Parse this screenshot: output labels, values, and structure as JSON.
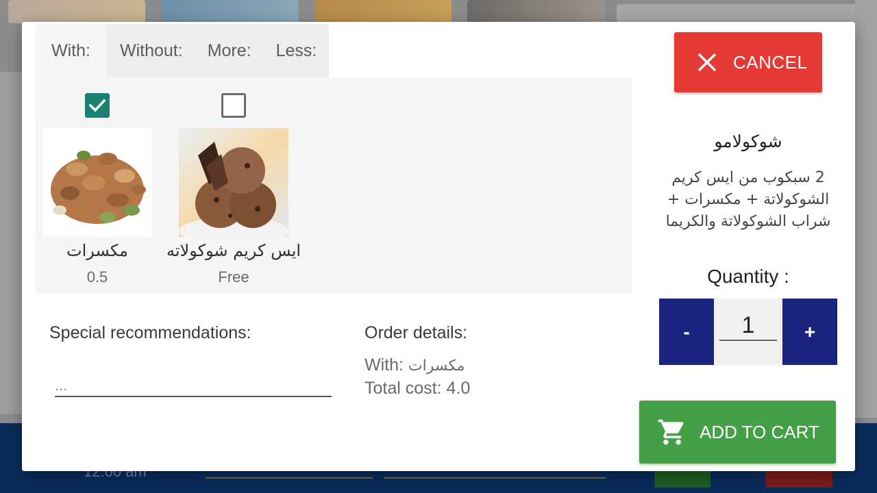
{
  "tabs": [
    {
      "label": "With:",
      "active": true
    },
    {
      "label": "Without:",
      "active": false
    },
    {
      "label": "More:",
      "active": false
    },
    {
      "label": "Less:",
      "active": false
    }
  ],
  "options": [
    {
      "name": "مكسرات",
      "price": "0.5",
      "checked": true,
      "image_icon": "mixed-nuts-image"
    },
    {
      "name": "ايس كريم شوكولاته",
      "price": "Free",
      "checked": false,
      "image_icon": "chocolate-ice-cream-image"
    }
  ],
  "special": {
    "label": "Special recommendations:",
    "placeholder": "..."
  },
  "order": {
    "label": "Order details:",
    "with_prefix": "With:",
    "with_value": "مكسرات",
    "total_prefix": "Total cost:",
    "total_value": "4.0"
  },
  "cancel": {
    "label": "CANCEL",
    "icon": "close-icon",
    "color": "#e53935"
  },
  "product": {
    "title": "شوكولامو",
    "description": "2 سبكوب من ايس كريم الشوكولاتة + مكسرات + شراب الشوكولاتة والكريما"
  },
  "quantity": {
    "label": "Quantity :",
    "minus": "-",
    "plus": "+",
    "value": "1",
    "button_color": "#1a237e"
  },
  "cart": {
    "label": "ADD TO CART",
    "icon": "cart-icon",
    "color": "#43a047"
  },
  "background": {
    "time": "12:00 am"
  },
  "colors": {
    "checkbox": "#1a8272"
  }
}
